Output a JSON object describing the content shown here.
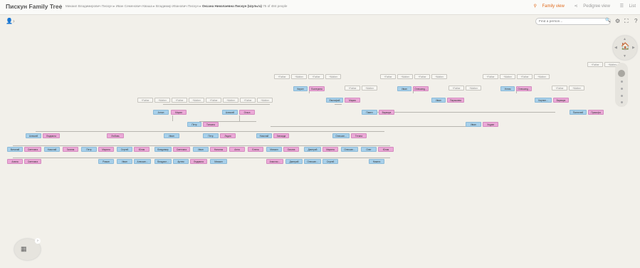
{
  "header": {
    "title": "Пискун Family Tree",
    "separator": "|",
    "breadcrumbs": [
      {
        "text": "Михаил Владимирович Пискун ▸ Иван Семенович Кваша ▸ Владимир Иванович Пискун ▸ "
      },
      {
        "text": "Оксана Николаевна Пискун (Шульга)"
      },
      {
        "text": "75 of 484 people"
      }
    ],
    "views": {
      "family": "Family view",
      "pedigree": "Pedigree view",
      "list": "List"
    }
  },
  "toolbar": {
    "person_toggle": "👤›",
    "search_placeholder": "Find a person...",
    "search_icon": "🔍",
    "settings_icon": "⚙",
    "fullscreen_icon": "⛶",
    "help_icon": "?"
  },
  "tree": {
    "people": {
      "n1": "Кирил",
      "n2": "Екатерина",
      "n3": "Евстафий",
      "n4": "Мария",
      "n5": "Иван",
      "n6": "Олександ...",
      "n7": "Павел",
      "n8": "Варвара",
      "n9": "Иван",
      "n10": "Параскева",
      "n11": "Устим",
      "n12": "Олександ...",
      "n13": "Карпин...",
      "n14": "Варвара",
      "n15": "Пантелей",
      "n16": "Пракофа",
      "n17": "Антон",
      "n18": "Мария",
      "n19": "Алексей",
      "n20": "Ольга",
      "n21": "Иван",
      "n22": "Ходим",
      "n23": "Петр",
      "n24": "Татьяна",
      "n25": "Алексей",
      "n26": "Людмила",
      "n27": "Любовь",
      "n28": "Иван",
      "n29": "Петр",
      "n30": "Лидия",
      "n31": "Николай",
      "n32": "Зинаида",
      "n33": "Олексан...",
      "n34": "Тетяна",
      "n35": "Виталий",
      "n36": "Светлана",
      "n37": "Николай",
      "n38": "Галина",
      "n39": "Петр",
      "n40": "Марина",
      "n41": "Сергей",
      "n42": "Юлия",
      "n43": "Владимир",
      "n44": "Светлана",
      "n45": "Иван",
      "n46": "Наталья",
      "n47": "Алла",
      "n48": "Елена",
      "n49": "Михаил",
      "n50": "Оксана",
      "n51": "Дмитрий",
      "n52": "Марина",
      "n53": "Олексан...",
      "n54": "Олег",
      "n55": "Юлия",
      "n56": "Алина",
      "n57": "Светлана",
      "n58": "Роман",
      "n59": "Иван",
      "n60": "Алексан...",
      "n61": "Владисл...",
      "n62": "Артем",
      "n63": "Людмила",
      "n64": "Михаил",
      "n65": "Анастас...",
      "n66": "Дмитрий",
      "n67": "Олексан...",
      "n68": "Сергей",
      "n69": "Никита"
    },
    "placeholder_label": "+Father",
    "placeholder_label_mother": "+Mother"
  },
  "navigation": {
    "center_icon": "🏠",
    "up": "▲",
    "down": "▼",
    "left": "◀",
    "right": "▶"
  },
  "zoom": {
    "level": 0.85
  },
  "chart_button": {
    "icon": "▦",
    "expand": "›"
  }
}
